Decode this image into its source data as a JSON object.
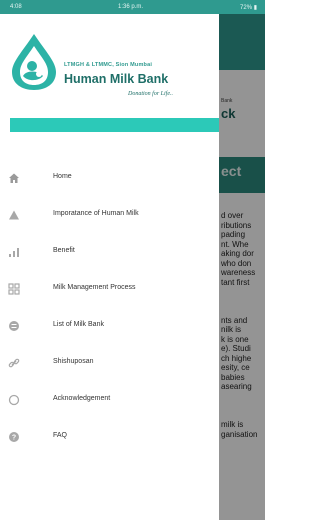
{
  "status_bar": {
    "left": "4:08",
    "center": "1:36 p.m.",
    "right": "72% ▮"
  },
  "background": {
    "header_sub": "Bank",
    "header_text": "ck",
    "bar_text": "ect",
    "lines": [
      "d over",
      "ributions",
      "pading",
      "nt. Whe",
      "aking dor",
      "who don",
      "wareness",
      "tant first",
      "",
      "",
      "nts and",
      "nilk is",
      "k is one",
      "e). Studi",
      "ch highe",
      "esity, ce",
      "babies",
      "asearing",
      "",
      "",
      "milk is",
      "ganisation"
    ]
  },
  "drawer": {
    "brand_sub": "LTMGH & LTMMC, Sion Mumbai",
    "brand_title": "Human Milk Bank",
    "brand_tag": "Donation for Life..",
    "brand_color": "#2f9a8f",
    "band_color": "#2cc9b8"
  },
  "menu": [
    {
      "label": "Home",
      "icon": "home-icon"
    },
    {
      "label": "Imporatance of Human Milk",
      "icon": "warning-triangle-icon"
    },
    {
      "label": "Benefit",
      "icon": "bar-chart-icon"
    },
    {
      "label": "Milk Management Process",
      "icon": "grid-icon"
    },
    {
      "label": "List of Milk Bank",
      "icon": "circle-list-icon"
    },
    {
      "label": "Shishuposan",
      "icon": "link-icon"
    },
    {
      "label": "Acknowledgement",
      "icon": "circle-outline-icon"
    },
    {
      "label": "FAQ",
      "icon": "question-icon"
    }
  ]
}
